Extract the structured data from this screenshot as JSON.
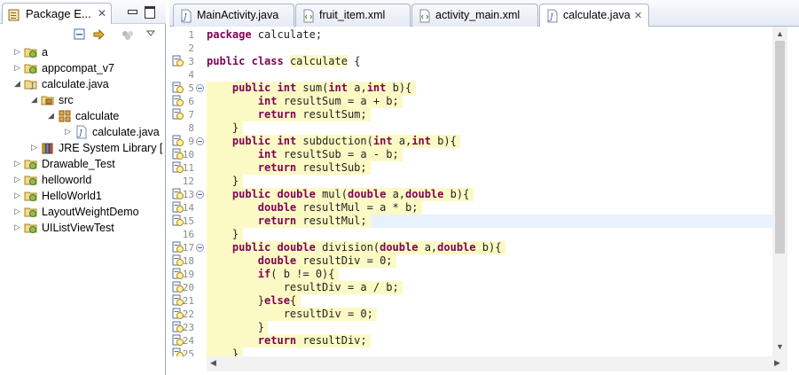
{
  "explorer": {
    "title": "Package E...",
    "close": "✕",
    "tree": [
      {
        "label": "a",
        "arrow": "▷",
        "indent": 0,
        "icon": "android-project-icon"
      },
      {
        "label": "appcompat_v7",
        "arrow": "▷",
        "indent": 0,
        "icon": "android-project-icon"
      },
      {
        "label": "calculate.java",
        "arrow": "◢",
        "indent": 0,
        "icon": "java-project-icon"
      },
      {
        "label": "src",
        "arrow": "◢",
        "indent": 1,
        "icon": "source-folder-icon"
      },
      {
        "label": "calculate",
        "arrow": "◢",
        "indent": 2,
        "icon": "package-icon"
      },
      {
        "label": "calculate.java",
        "arrow": "▷",
        "indent": 3,
        "icon": "java-file-icon"
      },
      {
        "label": "JRE System Library [",
        "arrow": "▷",
        "indent": 1,
        "icon": "library-icon"
      },
      {
        "label": "Drawable_Test",
        "arrow": "▷",
        "indent": 0,
        "icon": "android-project-icon"
      },
      {
        "label": "helloworld",
        "arrow": "▷",
        "indent": 0,
        "icon": "android-project-icon"
      },
      {
        "label": "HelloWorld1",
        "arrow": "▷",
        "indent": 0,
        "icon": "android-project-icon"
      },
      {
        "label": "LayoutWeightDemo",
        "arrow": "▷",
        "indent": 0,
        "icon": "android-project-icon"
      },
      {
        "label": "UIListViewTest",
        "arrow": "▷",
        "indent": 0,
        "icon": "android-project-icon"
      }
    ]
  },
  "editor": {
    "tabs": [
      {
        "label": "MainActivity.java",
        "icon": "java-file-icon",
        "active": false
      },
      {
        "label": "fruit_item.xml",
        "icon": "xml-file-icon",
        "active": false
      },
      {
        "label": "activity_main.xml",
        "icon": "xml-file-icon",
        "active": false
      },
      {
        "label": "calculate.java",
        "icon": "java-file-icon",
        "active": true,
        "close": "✕"
      }
    ],
    "lines": [
      {
        "n": "1",
        "text": "package calculate;"
      },
      {
        "n": "2",
        "text": ""
      },
      {
        "n": "3",
        "text": "public class calculate {"
      },
      {
        "n": "4",
        "text": ""
      },
      {
        "n": "5",
        "text": "    public int sum(int a,int b){"
      },
      {
        "n": "6",
        "text": "        int resultSum = a + b;"
      },
      {
        "n": "7",
        "text": "        return resultSum;"
      },
      {
        "n": "8",
        "text": "    }"
      },
      {
        "n": "9",
        "text": "    public int subduction(int a,int b){"
      },
      {
        "n": "10",
        "text": "        int resultSub = a - b;"
      },
      {
        "n": "11",
        "text": "        return resultSub;"
      },
      {
        "n": "12",
        "text": "    }"
      },
      {
        "n": "13",
        "text": "    public double mul(double a,double b){"
      },
      {
        "n": "14",
        "text": "        double resultMul = a * b;"
      },
      {
        "n": "15",
        "text": "        return resultMul;"
      },
      {
        "n": "16",
        "text": "    }"
      },
      {
        "n": "17",
        "text": "    public double division(double a,double b){"
      },
      {
        "n": "18",
        "text": "        double resultDiv = 0;"
      },
      {
        "n": "19",
        "text": "        if( b != 0){"
      },
      {
        "n": "20",
        "text": "            resultDiv = a / b;"
      },
      {
        "n": "21",
        "text": "        }else{"
      },
      {
        "n": "22",
        "text": "            resultDiv = 0;"
      },
      {
        "n": "23",
        "text": "        }"
      },
      {
        "n": "24",
        "text": "        return resultDiv;"
      },
      {
        "n": "25",
        "text": "    }"
      }
    ],
    "keywords": [
      "package",
      "public",
      "class",
      "int",
      "return",
      "double",
      "if",
      "else"
    ],
    "current_line": "15",
    "fold_lines": [
      "5",
      "9",
      "13",
      "17"
    ],
    "annotation_lines": [
      "3",
      "5",
      "6",
      "7",
      "9",
      "10",
      "11",
      "13",
      "14",
      "15",
      "17",
      "18",
      "19",
      "20",
      "21",
      "22",
      "23",
      "24",
      "25"
    ]
  },
  "colors": {
    "keyword": "#7f0055",
    "occurrence_highlight": "#fcfac4",
    "current_line": "#e8f2fe"
  }
}
